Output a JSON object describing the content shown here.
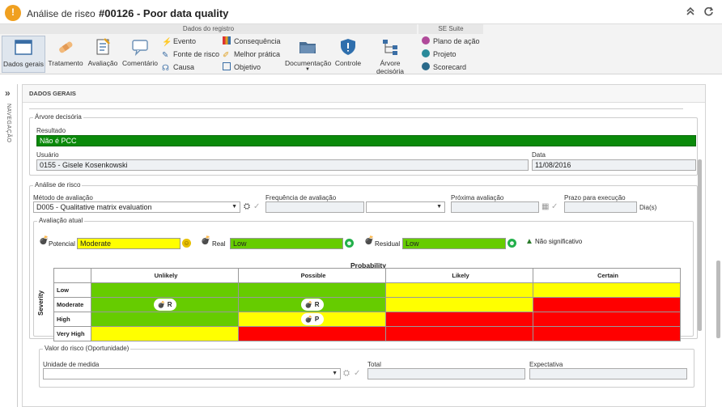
{
  "header": {
    "breadcrumb": "Análise de risco",
    "separator": "›",
    "title": "#00126 - Poor data quality",
    "collapse_icon": "double-chevron-up-icon",
    "refresh_icon": "refresh-icon"
  },
  "ribbon": {
    "group_dados": "Dados do registro",
    "group_suite": "SE Suite",
    "buttons": {
      "dados_gerais": "Dados gerais",
      "tratamento": "Tratamento",
      "avaliacao": "Avaliação",
      "comentario": "Comentário",
      "documentacao": "Documentação",
      "controle": "Controle",
      "arvore": "Árvore decisória"
    },
    "small": {
      "evento": "Evento",
      "fonte": "Fonte de risco",
      "causa": "Causa",
      "consequencia": "Consequência",
      "melhor_pratica": "Melhor prática",
      "objetivo": "Objetivo",
      "plano": "Plano de ação",
      "projeto": "Projeto",
      "scorecard": "Scorecard"
    },
    "doc_caret": "▼"
  },
  "sidenav": {
    "label": "NAVEGAÇÃO",
    "arrow": "»"
  },
  "section": {
    "title": "DADOS GERAIS"
  },
  "arvore": {
    "legend": "Árvore decisória",
    "resultado_label": "Resultado",
    "resultado_value": "Não é PCC",
    "usuario_label": "Usuário",
    "usuario_value": "0155 - Gisele Kosenkowski",
    "data_label": "Data",
    "data_value": "11/08/2016"
  },
  "analise": {
    "legend": "Análise de risco",
    "metodo_label": "Método de avaliação",
    "metodo_value": "D005 - Qualitative matrix evaluation",
    "freq_label": "Frequência de avaliação",
    "proxima_label": "Próxima avaliação",
    "prazo_label": "Prazo para execução",
    "dias_label": "Dia(s)",
    "avaliacao_legend": "Avaliação atual",
    "potencial_label": "Potencial",
    "potencial_value": "Moderate",
    "real_label": "Real",
    "real_value": "Low",
    "residual_label": "Residual",
    "residual_value": "Low",
    "nao_sig": "Não significativo",
    "colors": {
      "yellow": "#ffff00",
      "green": "#66cc00",
      "red": "#ff0000",
      "result_green": "#0a8a0a"
    }
  },
  "matrix": {
    "title": "Probability",
    "row_axis": "Severity",
    "columns": [
      "Unlikely",
      "Possible",
      "Likely",
      "Certain"
    ],
    "rows": [
      {
        "label": "Low",
        "cells": [
          "green",
          "green",
          "yellow",
          "yellow"
        ],
        "chips": [
          "",
          "",
          "",
          ""
        ]
      },
      {
        "label": "Moderate",
        "cells": [
          "green",
          "green",
          "yellow",
          "red"
        ],
        "chips": [
          "R",
          "R",
          "",
          ""
        ]
      },
      {
        "label": "High",
        "cells": [
          "green",
          "yellow",
          "red",
          "red"
        ],
        "chips": [
          "",
          "P",
          "",
          ""
        ]
      },
      {
        "label": "Very High",
        "cells": [
          "yellow",
          "red",
          "red",
          "red"
        ],
        "chips": [
          "",
          "",
          "",
          ""
        ]
      }
    ]
  },
  "valor": {
    "legend": "Valor do risco (Oportunidade)",
    "unidade_label": "Unidade de medida",
    "total_label": "Total",
    "expectativa_label": "Expectativa"
  }
}
